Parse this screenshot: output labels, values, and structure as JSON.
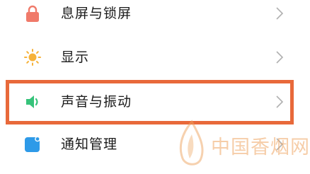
{
  "settings": {
    "items": [
      {
        "label": "息屏与锁屏",
        "icon": "lock-icon",
        "color": "#f07a6a"
      },
      {
        "label": "显示",
        "icon": "sun-icon",
        "color": "#f6b23a"
      },
      {
        "label": "声音与振动",
        "icon": "speaker-icon",
        "color": "#36c37a"
      },
      {
        "label": "通知管理",
        "icon": "notification-icon",
        "color": "#2e9ae8"
      }
    ]
  },
  "highlight": {
    "color": "#e8693a",
    "target": "声音与振动"
  },
  "watermark": {
    "text": "中国香烟网",
    "color": "#eea460"
  }
}
